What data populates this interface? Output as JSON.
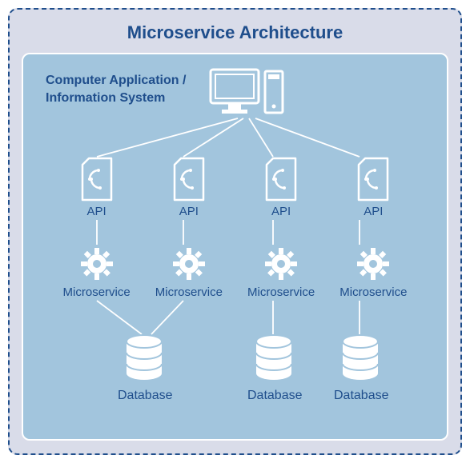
{
  "title": "Microservice Architecture",
  "app_label": "Computer Application / Information System",
  "columns": [
    {
      "api": "API",
      "ms": "Microservice",
      "db": "Database",
      "has_db": true,
      "merge_db_with_next": true
    },
    {
      "api": "API",
      "ms": "Microservice",
      "db": "",
      "has_db": false,
      "merge_db_with_next": false
    },
    {
      "api": "API",
      "ms": "Microservice",
      "db": "Database",
      "has_db": true,
      "merge_db_with_next": false
    },
    {
      "api": "API",
      "ms": "Microservice",
      "db": "Database",
      "has_db": true,
      "merge_db_with_next": false
    }
  ],
  "colors": {
    "accent": "#1f4e8c",
    "panel": "#a2c5dd",
    "outer": "#d9dce9",
    "icon": "#ffffff"
  }
}
